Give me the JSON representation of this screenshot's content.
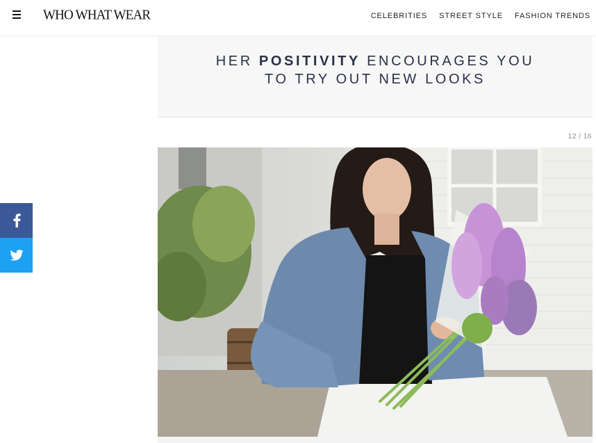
{
  "header": {
    "logo": "WHO WHAT WEAR",
    "nav": [
      "CELEBRITIES",
      "STREET STYLE",
      "FASHION TRENDS"
    ]
  },
  "quote": {
    "line1_pre": "HER ",
    "line1_bold": "POSITIVITY",
    "line1_post": " ENCOURAGES YOU",
    "line2": "TO TRY OUT NEW LOOKS"
  },
  "slide": {
    "counter": "12 / 16"
  },
  "share": {
    "facebook_icon": "facebook-icon",
    "twitter_icon": "twitter-icon"
  },
  "colors": {
    "facebook": "#3b5998",
    "twitter": "#1da1f2",
    "quote_text": "#2c3048"
  }
}
